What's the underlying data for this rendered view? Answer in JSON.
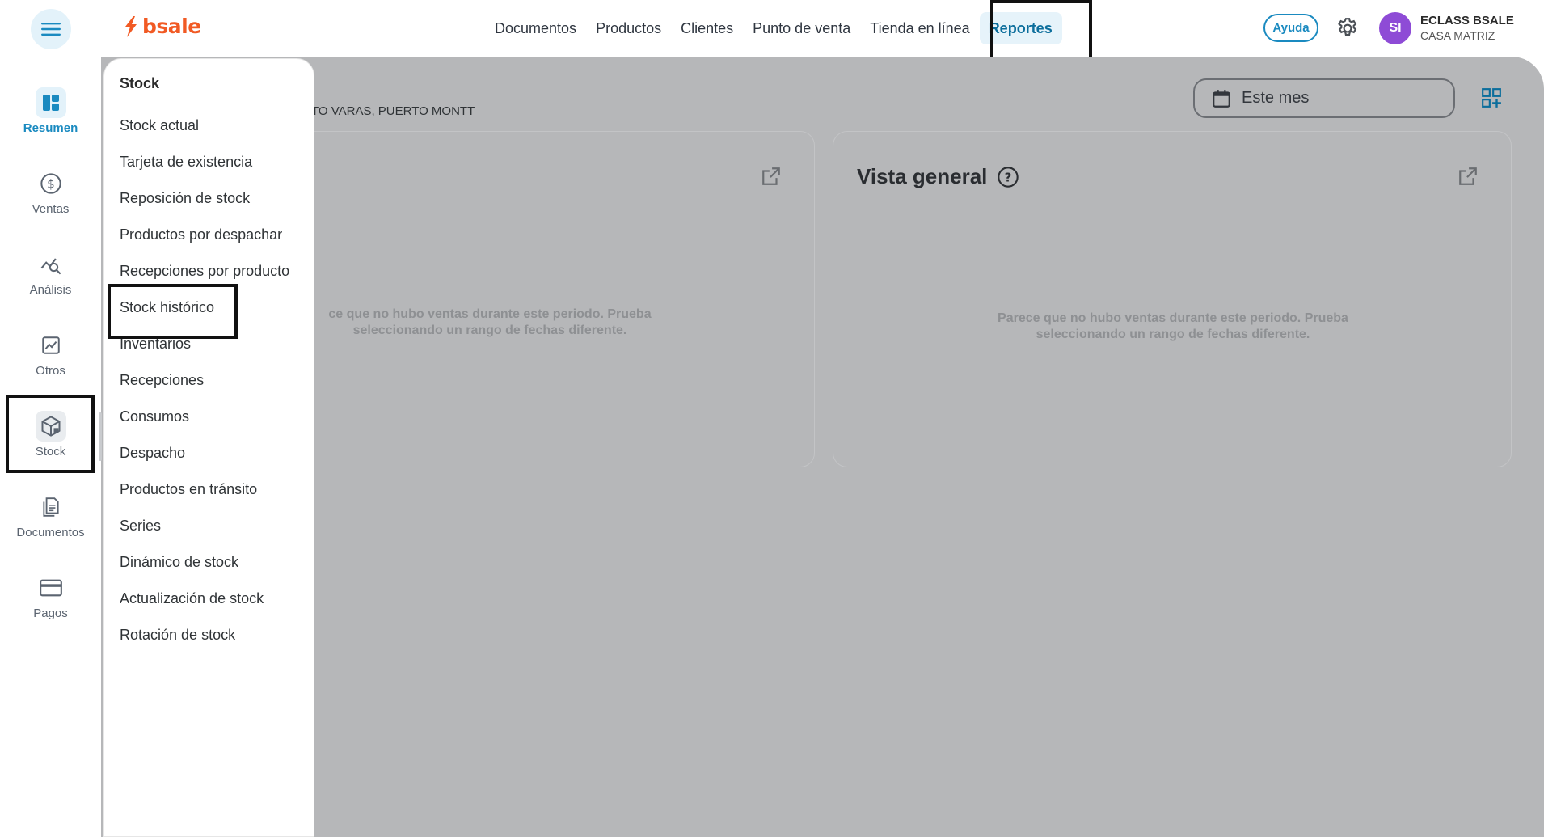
{
  "app": {
    "logo_text": "bsale",
    "brand_color": "#f15a24",
    "accent_color": "#1a8ac0"
  },
  "topnav": {
    "items": [
      {
        "label": "Documentos"
      },
      {
        "label": "Productos"
      },
      {
        "label": "Clientes"
      },
      {
        "label": "Punto de venta"
      },
      {
        "label": "Tienda en línea"
      },
      {
        "label": "Reportes",
        "active": true
      }
    ]
  },
  "header": {
    "help_label": "Ayuda",
    "avatar_initials": "SI",
    "company_name": "ECLASS BSALE",
    "branch_name": "CASA MATRIZ"
  },
  "rail": {
    "items": [
      {
        "label": "Resumen",
        "icon": "dashboard-icon",
        "active": true
      },
      {
        "label": "Ventas",
        "icon": "dollar-icon"
      },
      {
        "label": "Análisis",
        "icon": "analytics-icon"
      },
      {
        "label": "Otros",
        "icon": "chart-trend-icon"
      },
      {
        "label": "Stock",
        "icon": "box-icon",
        "selected": true
      },
      {
        "label": "Documentos",
        "icon": "documents-icon"
      },
      {
        "label": "Pagos",
        "icon": "card-icon"
      }
    ]
  },
  "main": {
    "date_filter_label": "Este mes",
    "breadcrumb_text": "TO VARAS, PUERTO MONTT",
    "card_left": {
      "empty_line1": "ce que no hubo ventas durante este periodo. Prueba",
      "empty_line2": "seleccionando un rango de fechas diferente."
    },
    "card_right": {
      "title": "Vista general",
      "empty_line1": "Parece que no hubo ventas durante este periodo. Prueba",
      "empty_line2": "seleccionando un rango de fechas diferente."
    }
  },
  "stock_menu": {
    "title": "Stock",
    "items": [
      "Stock actual",
      "Tarjeta de existencia",
      "Reposición de stock",
      "Productos por despachar",
      "Recepciones por producto",
      "Stock histórico",
      "Inventarios",
      "Recepciones",
      "Consumos",
      "Despacho",
      "Productos en tránsito",
      "Series",
      "Dinámico de stock",
      "Actualización de stock",
      "Rotación de stock"
    ]
  }
}
